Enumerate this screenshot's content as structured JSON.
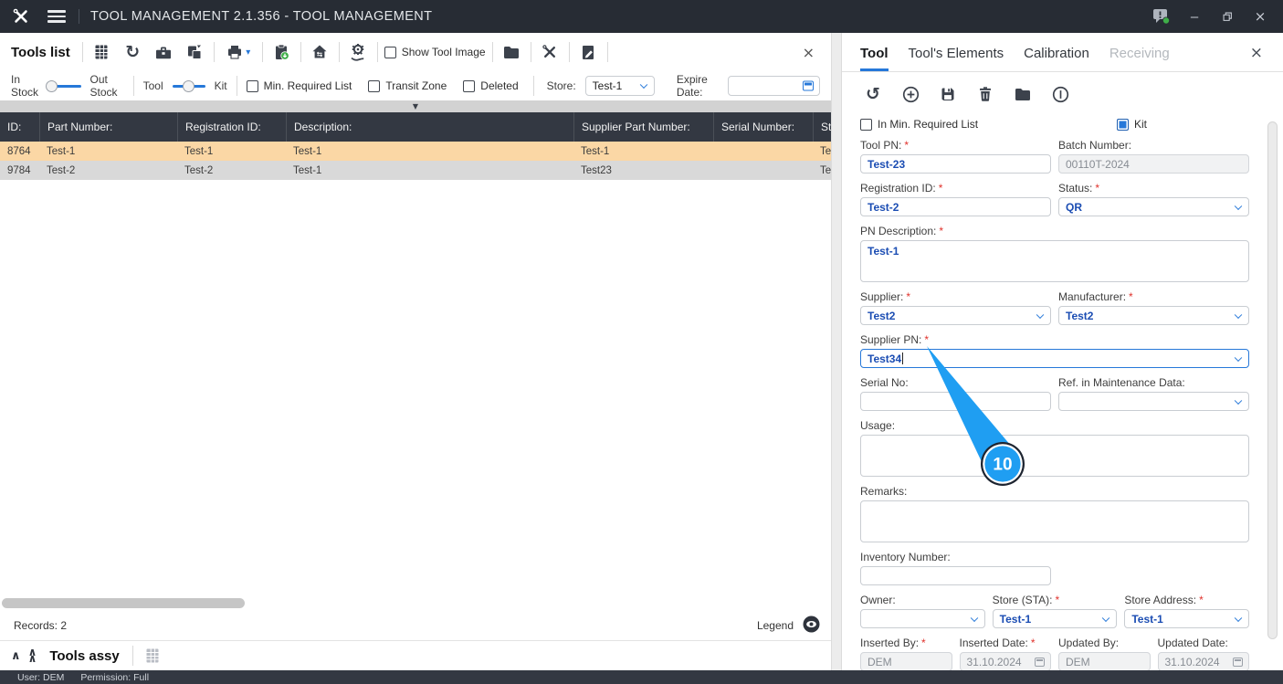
{
  "title_bar": {
    "title": "TOOL MANAGEMENT 2.1.356 - TOOL MANAGEMENT",
    "window_controls": [
      "minimize",
      "restore",
      "close"
    ],
    "icons": [
      "tools-logo",
      "hamburger-menu",
      "chat-notification"
    ]
  },
  "status_bar": {
    "user": "User: DEM",
    "permission": "Permission: Full"
  },
  "tools_list": {
    "title": "Tools list",
    "toolbar": {
      "icons": [
        "excel-export",
        "refresh",
        "toolbox",
        "copy",
        "print",
        "paste-import",
        "home-transfer",
        "hand-gear",
        "folder",
        "tools-exchange",
        "clipboard-edit",
        "close"
      ],
      "show_tool_image": "Show Tool Image"
    },
    "filters": {
      "stock_toggle": {
        "left": "In Stock",
        "right": "Out Stock",
        "position": "left"
      },
      "kind_toggle": {
        "left": "Tool",
        "right": "Kit",
        "position": "middle"
      },
      "checkboxes": [
        {
          "label": "Min. Required List",
          "checked": false
        },
        {
          "label": "Transit Zone",
          "checked": false
        },
        {
          "label": "Deleted",
          "checked": false
        }
      ],
      "store": {
        "label": "Store:",
        "value": "Test-1"
      },
      "expire_date": {
        "label": "Expire Date:",
        "value": ""
      }
    },
    "table": {
      "columns": [
        "ID:",
        "Part Number:",
        "Registration ID:",
        "Description:",
        "Supplier Part Number:",
        "Serial Number:",
        "Sto"
      ],
      "rows": [
        [
          "8764",
          "Test-1",
          "Test-1",
          "Test-1",
          "Test-1",
          "",
          "Test-"
        ],
        [
          "9784",
          "Test-2",
          "Test-2",
          "Test-1",
          "Test23",
          "",
          "Test-"
        ]
      ],
      "selected_row_index": 0
    },
    "records_label": "Records: 2",
    "legend_label": "Legend"
  },
  "tools_assy": {
    "title": "Tools assy"
  },
  "detail_panel": {
    "tabs": [
      {
        "label": "Tool",
        "state": "active"
      },
      {
        "label": "Tool's Elements",
        "state": "normal"
      },
      {
        "label": "Calibration",
        "state": "normal"
      },
      {
        "label": "Receiving",
        "state": "disabled"
      }
    ],
    "toolbar_icons": [
      "undo",
      "add",
      "save",
      "delete",
      "folder",
      "info"
    ],
    "checkboxes": {
      "in_min_required": {
        "label": "In Min. Required List",
        "checked": false
      },
      "kit": {
        "label": "Kit",
        "checked": true
      }
    },
    "fields": {
      "tool_pn": {
        "label": "Tool PN:",
        "req": "*",
        "value": "Test-23"
      },
      "batch_number": {
        "label": "Batch Number:",
        "value": "00110T-2024",
        "disabled": true
      },
      "registration_id": {
        "label": "Registration ID:",
        "req": "*",
        "value": "Test-2"
      },
      "status": {
        "label": "Status:",
        "req": "*",
        "value": "QR"
      },
      "pn_description": {
        "label": "PN Description:",
        "req": "*",
        "value": "Test-1"
      },
      "supplier": {
        "label": "Supplier:",
        "req": "*",
        "value": "Test2"
      },
      "manufacturer": {
        "label": "Manufacturer:",
        "req": "*",
        "value": "Test2"
      },
      "supplier_pn": {
        "label": "Supplier PN:",
        "req": "*",
        "value": "Test34",
        "focused": true
      },
      "serial_no": {
        "label": "Serial No:",
        "value": ""
      },
      "ref_maintenance": {
        "label": "Ref. in Maintenance Data:",
        "value": ""
      },
      "usage": {
        "label": "Usage:",
        "value": ""
      },
      "remarks": {
        "label": "Remarks:",
        "value": ""
      },
      "inventory_number": {
        "label": "Inventory Number:",
        "value": ""
      },
      "owner": {
        "label": "Owner:",
        "value": ""
      },
      "store_sta": {
        "label": "Store (STA):",
        "req": "*",
        "value": "Test-1"
      },
      "store_address": {
        "label": "Store Address:",
        "req": "*",
        "value": "Test-1"
      },
      "inserted_by": {
        "label": "Inserted By:",
        "req": "*",
        "value": "DEM",
        "disabled": true
      },
      "inserted_date": {
        "label": "Inserted Date:",
        "req": "*",
        "value": "31.10.2024",
        "disabled": true
      },
      "updated_by": {
        "label": "Updated By:",
        "value": "DEM",
        "disabled": true
      },
      "updated_date": {
        "label": "Updated Date:",
        "value": "31.10.2024",
        "disabled": true
      }
    },
    "callout": {
      "number": "10"
    }
  },
  "colors": {
    "titlebar_bg": "#272c34",
    "table_header_bg": "#333842",
    "selected_row": "#fbd7a5",
    "alt_row": "#d9d9d9",
    "accent_blue": "#2678d9",
    "value_blue": "#1b4db3",
    "callout_blue": "#1f9ef2",
    "required_red": "#e0322c",
    "badge_green": "#3fae49"
  }
}
